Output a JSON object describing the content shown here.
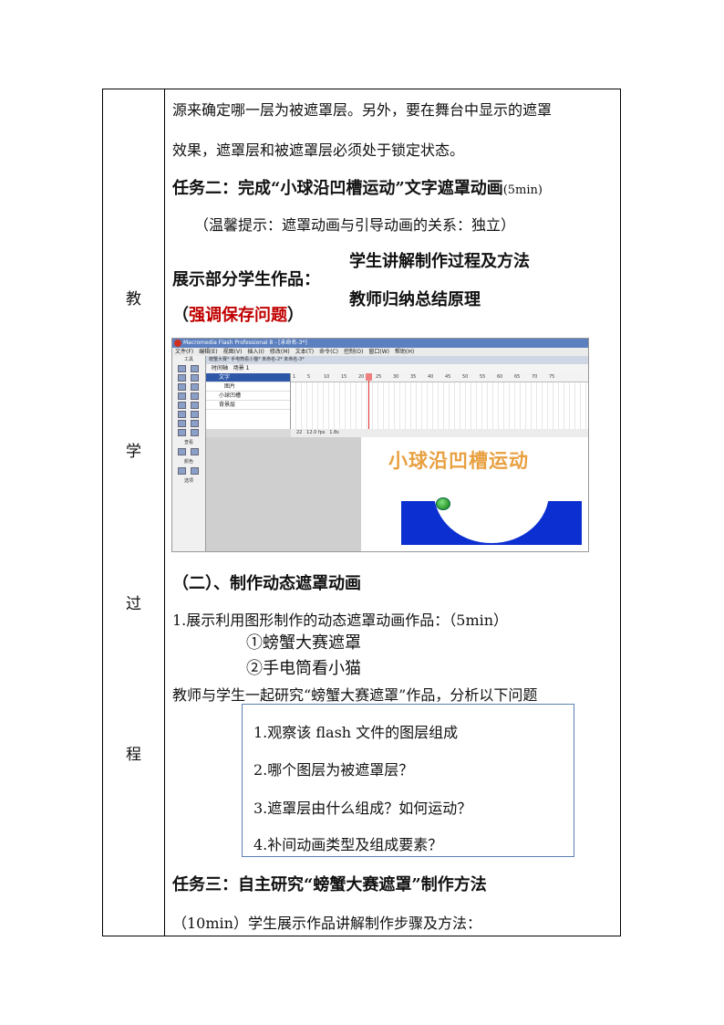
{
  "side_chars": [
    "教",
    "学",
    "过",
    "程"
  ],
  "lines": {
    "l1": "源来确定哪一层为被遮罩层。另外，要在舞台中显示的遮罩",
    "l2": "效果，遮罩层和被遮罩层必须处于锁定状态。",
    "task2": "任务二：完成“小球沿凹槽运动”文字遮罩动画",
    "task2_time": "(5min)",
    "tip": "（温馨提示：遮罩动画与引导动画的关系：独立）",
    "show_works": "展示部分学生作品：",
    "student_explain": "学生讲解制作过程及方法",
    "teacher_summary": "教师归纳总结原理",
    "save_open": "（",
    "save_emph": "强调保存问题",
    "save_close": "）",
    "section2": "（二）、制作动态遮罩动画",
    "item1": "1.展示利用图形制作的动态遮罩动画作品：（5min）",
    "item1a": "①螃蟹大赛遮罩",
    "item1b": "②手电筒看小猫",
    "study": "教师与学生一起研究“螃蟹大赛遮罩”作品，分析以下问题",
    "task3": "任务三：自主研究“螃蟹大赛遮罩”制作方法",
    "task3_detail": "（10min）学生展示作品讲解制作步骤及方法："
  },
  "questions": [
    "1.观察该 flash 文件的图层组成",
    "2.哪个图层为被遮罩层？",
    "3.遮罩层由什么组成？如何运动？",
    "4.补间动画类型及组成要素？"
  ],
  "screenshot": {
    "window_title": "Macromedia Flash Professional 8 - [未命名-3*]",
    "menu": [
      "文件(F)",
      "编辑(E)",
      "视图(V)",
      "插入(I)",
      "修改(M)",
      "文本(T)",
      "命令(C)",
      "控制(O)",
      "窗口(W)",
      "帮助(H)"
    ],
    "tools_label": "工具",
    "view_label": "查看",
    "color_label": "颜色",
    "options_label": "选项",
    "doc_tabs": "螃蟹大赛*   手电筒看小猫*   未命名-2*   未命名-3*",
    "timeline_button": "时间轴",
    "scene": "场景 1",
    "layers": [
      "文字",
      "图片",
      "小球凹槽",
      "背景层"
    ],
    "ruler": [
      "1",
      "5",
      "10",
      "15",
      "20",
      "25",
      "30",
      "35",
      "40",
      "45",
      "50",
      "55",
      "60",
      "65",
      "70",
      "75"
    ],
    "frame": "22",
    "fps": "12.0 fps",
    "time": "1.8s",
    "stage_title": "小球沿凹槽运动"
  }
}
